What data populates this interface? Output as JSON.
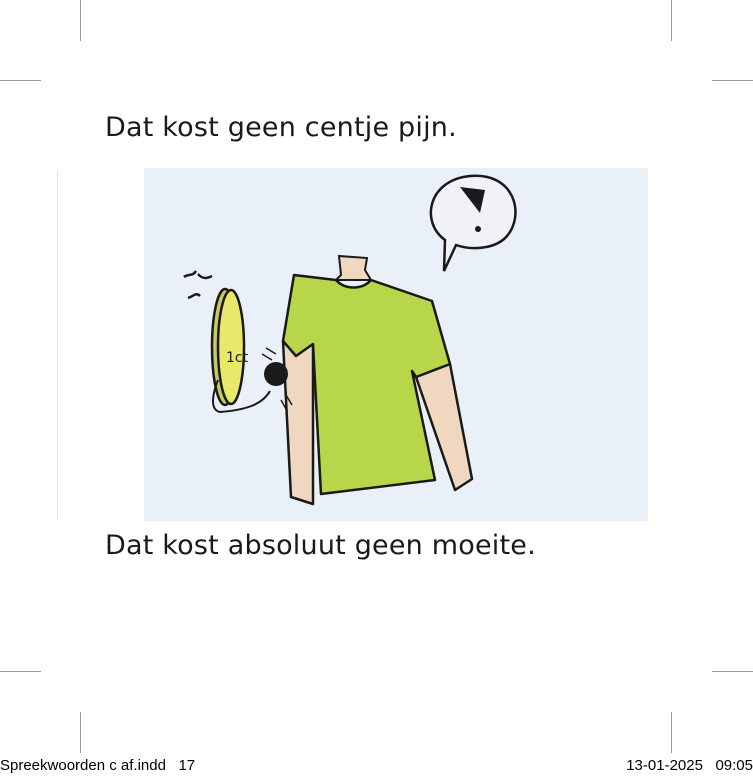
{
  "page": {
    "heading_top": "Dat kost geen centje pijn.",
    "heading_bottom": "Dat kost absoluut geen moeite.",
    "illustration": {
      "icon": "drawing-coin-hitting-man-in-green-shirt",
      "coin_label": "1ct"
    },
    "colors": {
      "shirt": "#b8d64a",
      "coin": "#e8e86a",
      "paper": "#eaf0f8",
      "skin": "#f0d7c0"
    }
  },
  "footer": {
    "file_label": "Spreekwoorden c af.indd   17",
    "timestamp": "13-01-2025   09:05"
  }
}
